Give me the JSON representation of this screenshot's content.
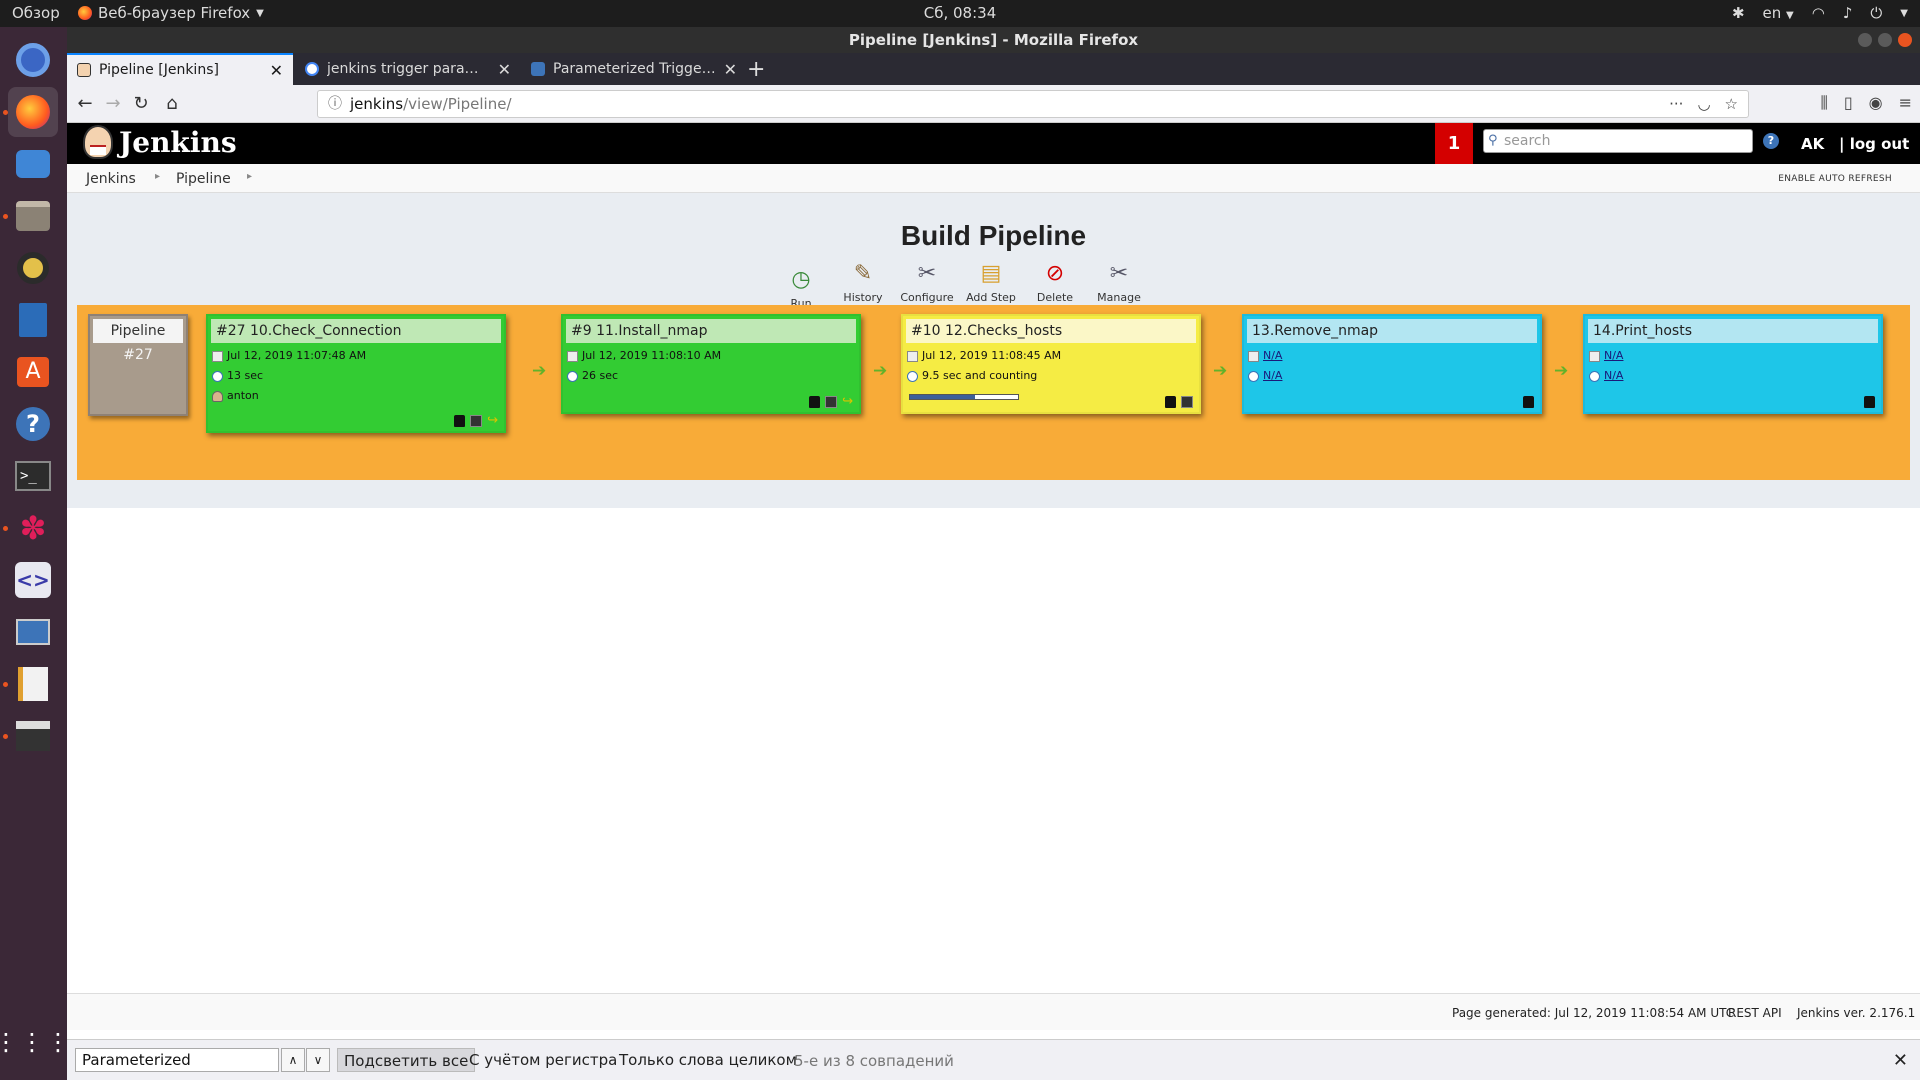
{
  "desktop": {
    "overview": "Обзор",
    "app_name": "Веб-браузер Firefox",
    "clock": "Сб, 08:34",
    "lang": "en"
  },
  "window": {
    "title": "Pipeline [Jenkins] - Mozilla Firefox"
  },
  "tabs": [
    {
      "label": "Pipeline [Jenkins]",
      "active": true
    },
    {
      "label": "jenkins trigger parameter",
      "active": false
    },
    {
      "label": "Parameterized Trigger Plugin",
      "active": false
    }
  ],
  "urlbar": {
    "host": "jenkins",
    "path": "/view/Pipeline/"
  },
  "jenkins": {
    "logo_text": "Jenkins",
    "notification_count": "1",
    "search_placeholder": "search",
    "help": "?",
    "user": "AK",
    "logout": "| log out",
    "breadcrumb": [
      "Jenkins",
      "Pipeline"
    ],
    "auto_refresh": "ENABLE AUTO REFRESH",
    "page_title": "Build Pipeline",
    "toolbar": [
      {
        "label": "Run",
        "icon": "run-icon"
      },
      {
        "label": "History",
        "icon": "history-icon"
      },
      {
        "label": "Configure",
        "icon": "configure-icon"
      },
      {
        "label": "Add Step",
        "icon": "add-step-icon"
      },
      {
        "label": "Delete",
        "icon": "delete-icon"
      },
      {
        "label": "Manage",
        "icon": "manage-icon"
      }
    ],
    "pipeline": {
      "label": "Pipeline",
      "number": "#27"
    },
    "builds": [
      {
        "title": "#27 10.Check_Connection",
        "date": "Jul 12, 2019 11:07:48 AM",
        "duration": "13 sec",
        "user": "anton",
        "status": "success",
        "color": "#33cc33"
      },
      {
        "title": "#9 11.Install_nmap",
        "date": "Jul 12, 2019 11:08:10 AM",
        "duration": "26 sec",
        "status": "success",
        "color": "#33cc33"
      },
      {
        "title": "#10 12.Checks_hosts",
        "date": "Jul 12, 2019 11:08:45 AM",
        "duration": "9.5 sec and counting",
        "status": "running",
        "progress": 0.6,
        "color": "#f5ec44"
      },
      {
        "title": "13.Remove_nmap",
        "date": "N/A",
        "duration": "N/A",
        "status": "pending",
        "color": "#1ec6e8"
      },
      {
        "title": "14.Print_hosts",
        "date": "N/A",
        "duration": "N/A",
        "status": "pending",
        "color": "#1ec6e8"
      }
    ],
    "footer": {
      "generated": "Page generated: Jul 12, 2019 11:08:54 AM UTC",
      "rest_api": "REST API",
      "version": "Jenkins ver. 2.176.1"
    }
  },
  "findbar": {
    "query": "Parameterized",
    "highlight_all": "Подсветить все",
    "match_case": "С учётом регистра",
    "whole_words": "Только слова целиком",
    "status": "5-е из 8 совпадений"
  }
}
